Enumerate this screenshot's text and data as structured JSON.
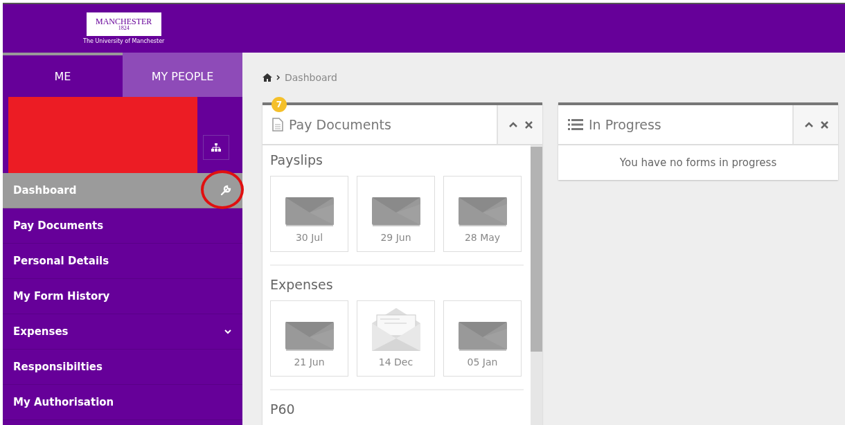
{
  "header": {
    "logo": {
      "name": "MANCHESTER",
      "year": "1824",
      "subtitle": "The University of Manchester"
    }
  },
  "tabs": [
    {
      "label": "ME",
      "selected": true
    },
    {
      "label": "MY PEOPLE",
      "selected": false
    }
  ],
  "sidebar": {
    "items": [
      {
        "label": "Dashboard",
        "kind": "link",
        "selected": true
      },
      {
        "label": "Pay Documents",
        "kind": "link",
        "selected": false
      },
      {
        "label": "Personal Details",
        "kind": "link",
        "selected": false
      },
      {
        "label": "My Form History",
        "kind": "link",
        "selected": false
      },
      {
        "label": "Expenses",
        "kind": "group",
        "expanded": false,
        "selected": false
      },
      {
        "label": "Responsibilties",
        "kind": "link",
        "selected": false
      },
      {
        "label": "My Authorisation",
        "kind": "link",
        "selected": false
      }
    ]
  },
  "breadcrumb": [
    "Dashboard"
  ],
  "pay_documents": {
    "title": "Pay Documents",
    "badge": "7",
    "sections": [
      {
        "title": "Payslips",
        "items": [
          {
            "date": "30 Jul",
            "opened": false
          },
          {
            "date": "29 Jun",
            "opened": false
          },
          {
            "date": "28 May",
            "opened": false
          }
        ]
      },
      {
        "title": "Expenses",
        "items": [
          {
            "date": "21 Jun",
            "opened": false
          },
          {
            "date": "14 Dec",
            "opened": true
          },
          {
            "date": "05 Jan",
            "opened": false
          }
        ]
      },
      {
        "title": "P60"
      }
    ]
  },
  "in_progress": {
    "title": "In Progress",
    "message": "You have no forms in progress"
  }
}
